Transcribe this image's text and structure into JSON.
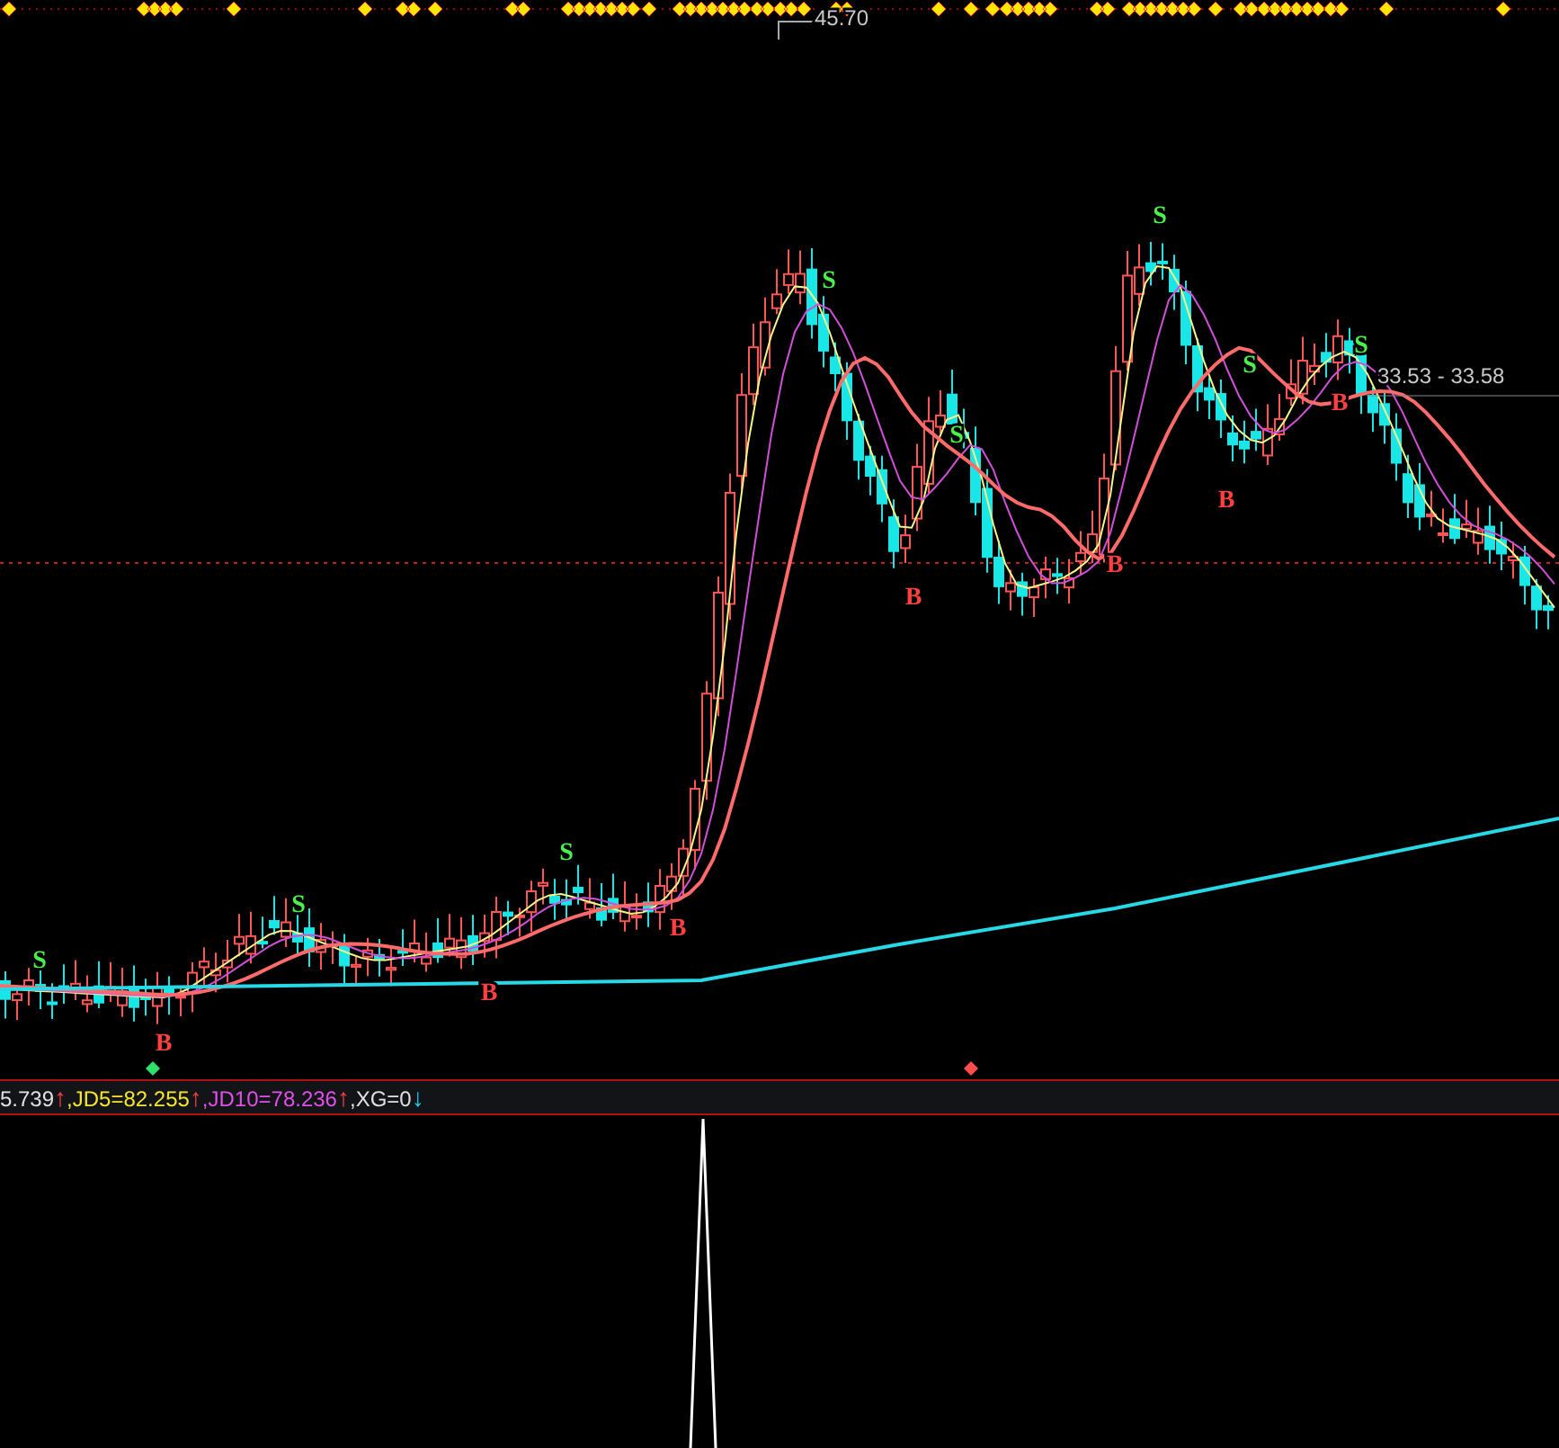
{
  "price_labels": [
    {
      "kind": "high",
      "text": "45.70"
    },
    {
      "kind": "current",
      "text": "33.53 - 33.58"
    }
  ],
  "signals": [
    {
      "kind": "sell",
      "text": "S"
    },
    {
      "kind": "buy",
      "text": "B"
    },
    {
      "kind": "sell",
      "text": "S"
    },
    {
      "kind": "buy",
      "text": "B"
    },
    {
      "kind": "sell",
      "text": "S"
    },
    {
      "kind": "buy",
      "text": "B"
    },
    {
      "kind": "sell",
      "text": "S"
    },
    {
      "kind": "buy",
      "text": "B"
    },
    {
      "kind": "sell",
      "text": "S"
    },
    {
      "kind": "buy",
      "text": "B"
    },
    {
      "kind": "sell",
      "text": "S"
    },
    {
      "kind": "buy",
      "text": "B"
    },
    {
      "kind": "sell",
      "text": "S"
    },
    {
      "kind": "buy",
      "text": "B"
    },
    {
      "kind": "sell",
      "text": "S"
    }
  ],
  "indicator_strip": [
    {
      "kind": "value",
      "text": "5.739",
      "color": "#e0e0e0"
    },
    {
      "kind": "arrow",
      "text": "↑",
      "color": "#ff4040"
    },
    {
      "kind": "value",
      "text": ",JD5=82.255",
      "color": "#f5e52c"
    },
    {
      "kind": "arrow",
      "text": "↑",
      "color": "#ff4040"
    },
    {
      "kind": "value",
      "text": ",JD10=78.236",
      "color": "#e04fe8"
    },
    {
      "kind": "arrow",
      "text": "↑",
      "color": "#ff4040"
    },
    {
      "kind": "value",
      "text": ",XG=0",
      "color": "#e0e0e0"
    },
    {
      "kind": "arrow",
      "text": "↓",
      "color": "#19d0ff"
    }
  ]
}
